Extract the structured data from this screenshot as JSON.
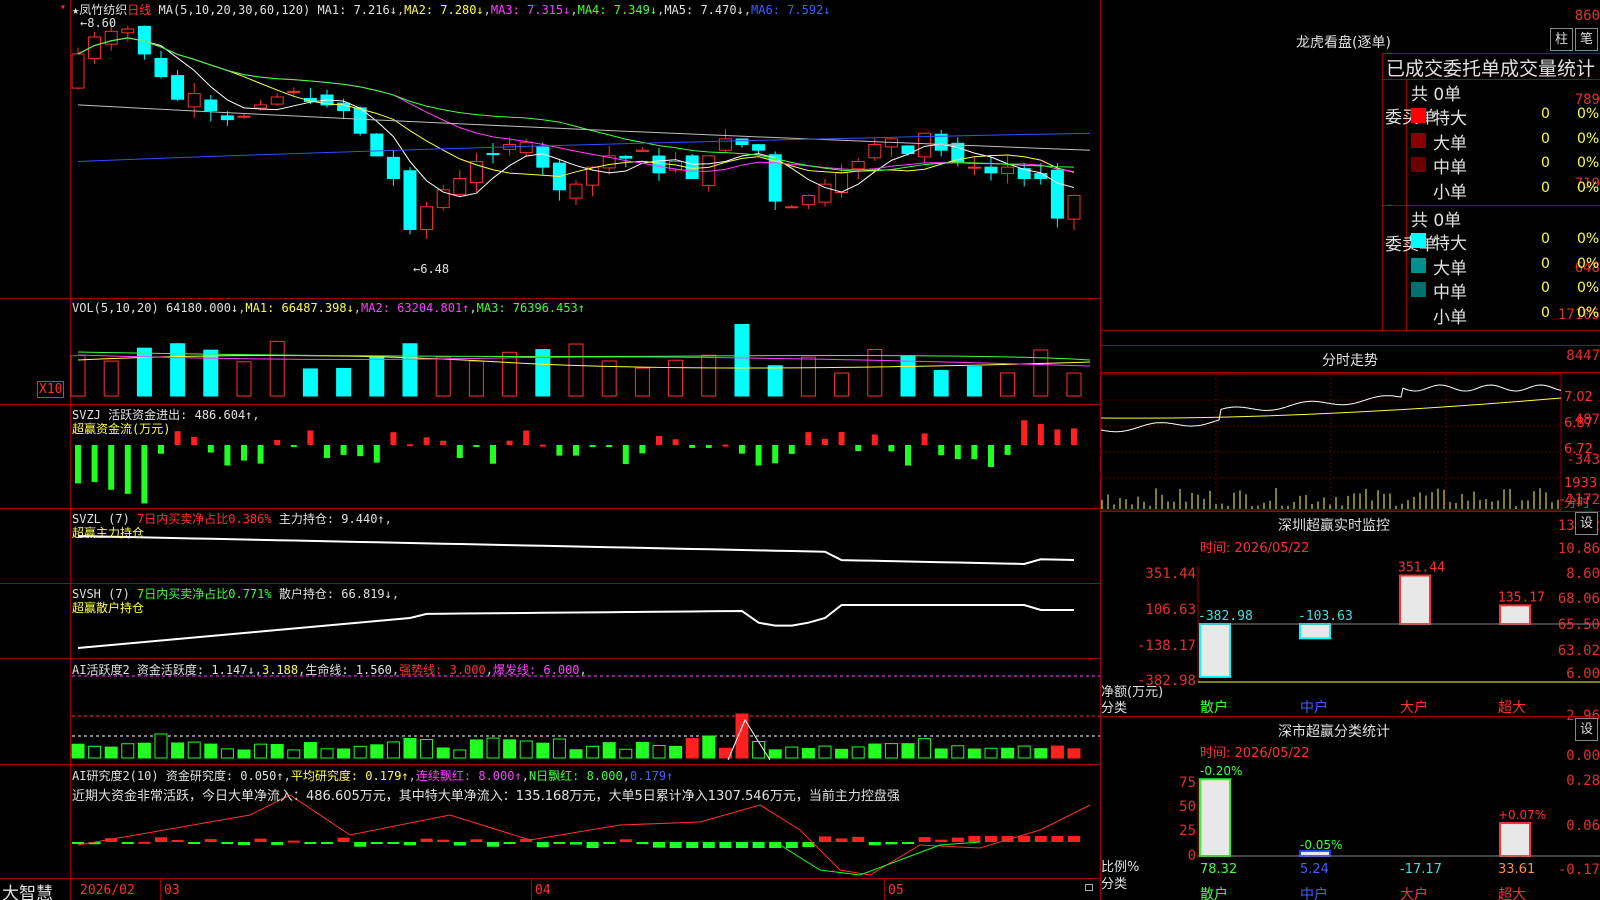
{
  "stock": {
    "name": "凤竹纺织",
    "period": "日线",
    "ma_label": "MA(5,10,20,30,60,120)",
    "ma1": "MA1: 7.216↓",
    "ma2": "MA2: 7.280↓",
    "ma3": "MA3: 7.315↓",
    "ma4": "MA4: 7.349↓",
    "ma5": "MA5: 7.470↓",
    "ma6": "MA6: 7.592↓",
    "high_mark": "8.60",
    "low_mark": "6.48"
  },
  "price_axis": [
    "860",
    "789",
    "719",
    "648"
  ],
  "vol": {
    "label": "VOL(5,10,20)",
    "v": "64180.000↓",
    "ma1": "MA1: 66487.398↓",
    "ma2": "MA2: 63204.801↑",
    "ma3": "MA3: 76396.453↑",
    "axis": [
      "17105",
      "8447"
    ],
    "unit": "X10"
  },
  "svzj": {
    "label": "SVZJ",
    "text": "活跃资金进出: 486.604↑",
    "sub": "超赢资金流(万元)",
    "axis": [
      "487",
      "-343",
      "-1172"
    ]
  },
  "svzl": {
    "label": "SVZL (7)",
    "text": "7日内买卖净占比0.386%",
    "hold": "主力持仓: 9.440↑",
    "sub": "超赢主力持仓",
    "axis": [
      "13.12",
      "10.86",
      "8.60"
    ]
  },
  "svsh": {
    "label": "SVSH (7)",
    "text": "7日内买卖净占比0.771%",
    "hold": "散户持仓: 66.819↓",
    "sub": "超赢散户持仓",
    "axis": [
      "68.06",
      "65.50",
      "63.02"
    ]
  },
  "ai1": {
    "label": "AI活跃度2",
    "a": "资金活跃度: 1.147↓",
    "b": "3.188",
    "c": "生命线: 1.560",
    "d": "强势线: 3.000",
    "e": "爆发线: 6.000",
    "axis": [
      "6.00",
      "2.96",
      "0.00"
    ]
  },
  "ai2": {
    "label": "AI研究度2(10)",
    "a": "资金研究度: 0.050↑",
    "b": "平均研究度: 0.179↑",
    "c": "连续飘红: 8.000↑",
    "d": "N日飘红: 8.000",
    "e": "0.179↑",
    "axis": [
      "0.28",
      "0.06",
      "-0.17"
    ],
    "note": "近期大资金非常活跃，今日大单净流入：486.605万元，其中特大单净流入：135.168万元，大单5日累计净入1307.546万元，当前主力控盘强"
  },
  "dates": [
    "2026/02",
    "03",
    "04",
    "05"
  ],
  "brand": "大智慧",
  "dragon": {
    "title": "龙虎看盘(逐单)",
    "tab1": "柱",
    "tab2": "笔",
    "header": "已成交委托单成交量统计",
    "buy": {
      "side": "委买单",
      "total": "共 0单",
      "rows": [
        {
          "name": "特大",
          "v": "0",
          "p": "0%",
          "color": "#ff0000"
        },
        {
          "name": "大单",
          "v": "0",
          "p": "0%",
          "color": "#8a0000"
        },
        {
          "name": "中单",
          "v": "0",
          "p": "0%",
          "color": "#6a0000"
        },
        {
          "name": "小单",
          "v": "0",
          "p": "0%",
          "color": ""
        }
      ]
    },
    "sell": {
      "side": "委卖单",
      "total": "共 0单",
      "rows": [
        {
          "name": "特大",
          "v": "0",
          "p": "0%",
          "color": "#00ffff"
        },
        {
          "name": "大单",
          "v": "0",
          "p": "0%",
          "color": "#009090"
        },
        {
          "name": "中单",
          "v": "0",
          "p": "0%",
          "color": "#007070"
        },
        {
          "name": "小单",
          "v": "0",
          "p": "0%",
          "color": ""
        }
      ]
    }
  },
  "intraday": {
    "title": "分时走势",
    "axis": [
      "7.02",
      "6.87",
      "6.72"
    ],
    "vol": "1933",
    "unit": "分时"
  },
  "monitor": {
    "title": "深圳超赢实时监控",
    "set": "设",
    "time": "时间: 2026/05/22",
    "axis": [
      "351.44",
      "106.63",
      "-138.17",
      "-382.98"
    ],
    "ylabel": "净额(万元)",
    "xlabel": "分类",
    "cats": [
      "散户",
      "中户",
      "大户",
      "超大"
    ],
    "values": [
      -382.98,
      -103.63,
      351.44,
      135.17
    ]
  },
  "stats": {
    "title": "深市超赢分类统计",
    "set": "设",
    "time": "时间: 2026/05/22",
    "axis": [
      "75",
      "50",
      "25",
      "0"
    ],
    "ylabel": "比例%",
    "xlabel": "分类",
    "cats": [
      "散户",
      "中户",
      "大户",
      "超大"
    ],
    "bars": [
      78.32,
      5.24,
      -17.17,
      33.61
    ],
    "vals": [
      "78.32",
      "5.24",
      "-17.17",
      "33.61"
    ],
    "tops": [
      "-0.20%",
      "-0.05%",
      "",
      "+0.07%"
    ]
  }
}
